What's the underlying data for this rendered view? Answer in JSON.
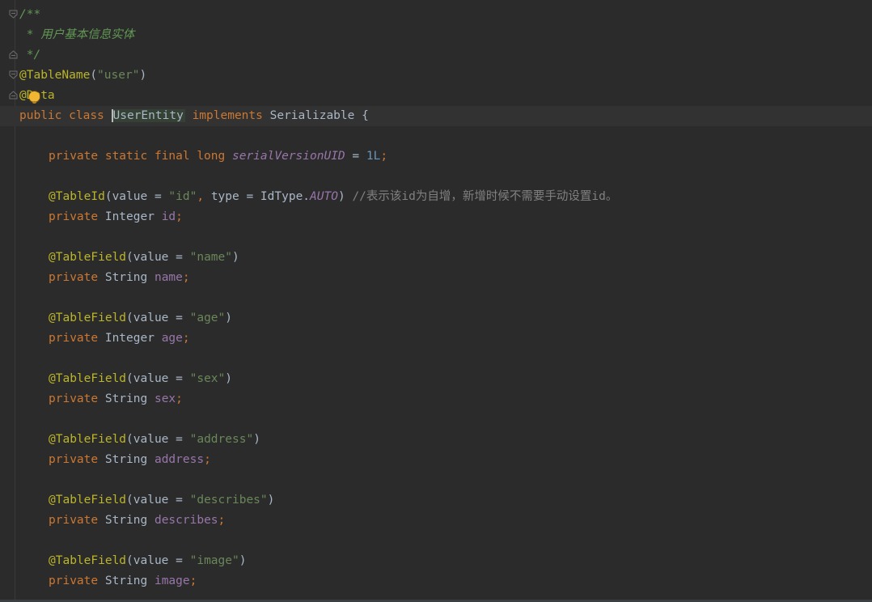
{
  "editor": {
    "colors": {
      "background": "#2b2b2b",
      "current_line": "#323232",
      "keyword": "#cc7832",
      "annotation": "#bbb529",
      "string": "#6a8759",
      "field": "#9876aa",
      "number": "#6897bb",
      "doc_comment": "#629755",
      "line_comment": "#808080",
      "text": "#a9b7c6"
    },
    "icons": {
      "fold": "fold-toggle-icon",
      "intention": "lightbulb-icon"
    }
  },
  "code": {
    "l1": {
      "doc_open": "/**"
    },
    "l2": {
      "doc_text": " * 用户基本信息实体"
    },
    "l3": {
      "doc_close": " */"
    },
    "l4": {
      "ann": "@TableName",
      "open": "(",
      "str": "\"user\"",
      "close": ")"
    },
    "l5": {
      "ann": "@Data"
    },
    "l6": {
      "kw_public": "public",
      "kw_class": "class",
      "class_name": "UserEntity",
      "kw_implements": "implements",
      "iface": "Serializable",
      "brace": "{"
    },
    "l8": {
      "mods": "private static final long",
      "field": "serialVersionUID",
      "eq": " = ",
      "num": "1L",
      "semi": ";"
    },
    "l10": {
      "ann": "@TableId",
      "p1": "(value = ",
      "s1": "\"id\"",
      "p2": ", ",
      "type_kw": "type",
      "p3": " = IdType.",
      "enum_const": "AUTO",
      "p4": ") ",
      "comment": "//表示该id为自增，新增时候不需要手动设置id。"
    },
    "l11": {
      "kw": "private",
      "type": "Integer",
      "field": "id",
      "semi": ";"
    },
    "l13": {
      "ann": "@TableField",
      "open": "(value = ",
      "str": "\"name\"",
      "close": ")"
    },
    "l14": {
      "kw": "private",
      "type": "String",
      "field": "name",
      "semi": ";"
    },
    "l16": {
      "ann": "@TableField",
      "open": "(value = ",
      "str": "\"age\"",
      "close": ")"
    },
    "l17": {
      "kw": "private",
      "type": "Integer",
      "field": "age",
      "semi": ";"
    },
    "l19": {
      "ann": "@TableField",
      "open": "(value = ",
      "str": "\"sex\"",
      "close": ")"
    },
    "l20": {
      "kw": "private",
      "type": "String",
      "field": "sex",
      "semi": ";"
    },
    "l22": {
      "ann": "@TableField",
      "open": "(value = ",
      "str": "\"address\"",
      "close": ")"
    },
    "l23": {
      "kw": "private",
      "type": "String",
      "field": "address",
      "semi": ";"
    },
    "l25": {
      "ann": "@TableField",
      "open": "(value = ",
      "str": "\"describes\"",
      "close": ")"
    },
    "l26": {
      "kw": "private",
      "type": "String",
      "field": "describes",
      "semi": ";"
    },
    "l28": {
      "ann": "@TableField",
      "open": "(value = ",
      "str": "\"image\"",
      "close": ")"
    },
    "l29": {
      "kw": "private",
      "type": "String",
      "field": "image",
      "semi": ";"
    }
  }
}
